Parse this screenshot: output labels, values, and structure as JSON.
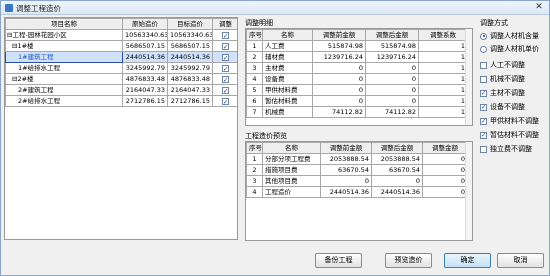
{
  "window": {
    "title": "调整工程造价",
    "close_glyph": "✕"
  },
  "left_table": {
    "headers": [
      "项目名称",
      "原始造价",
      "目标造价",
      "调整"
    ],
    "rows": [
      {
        "name": "⊟工程-园林花园小区",
        "orig": "10563340.63",
        "target": "10563340.63",
        "checked": true,
        "selected": false
      },
      {
        "name": "⊟1#楼",
        "orig": "5686507.15",
        "target": "5686507.15",
        "checked": true,
        "selected": false
      },
      {
        "name": "1#建筑工程",
        "orig": "2440514.36",
        "target": "2440514.36",
        "checked": true,
        "selected": true
      },
      {
        "name": "1#给排水工程",
        "orig": "3245992.79",
        "target": "3245992.79",
        "checked": true,
        "selected": false
      },
      {
        "name": "⊟2#楼",
        "orig": "4876833.48",
        "target": "4876833.48",
        "checked": true,
        "selected": false
      },
      {
        "name": "2#建筑工程",
        "orig": "2164047.33",
        "target": "2164047.33",
        "checked": true,
        "selected": false
      },
      {
        "name": "2#给排水工程",
        "orig": "2712786.15",
        "target": "2712786.15",
        "checked": true,
        "selected": false
      }
    ]
  },
  "detail": {
    "label": "调整明细",
    "headers": [
      "序号",
      "名称",
      "调整前金额",
      "调整后金额",
      "调整系数"
    ],
    "rows": [
      {
        "no": "1",
        "name": "人工费",
        "before": "515874.98",
        "after": "515874.98",
        "coef": "1"
      },
      {
        "no": "2",
        "name": "辅材费",
        "before": "1239716.24",
        "after": "1239716.24",
        "coef": "1"
      },
      {
        "no": "3",
        "name": "主材费",
        "before": "0",
        "after": "0",
        "coef": "1"
      },
      {
        "no": "4",
        "name": "设备费",
        "before": "0",
        "after": "0",
        "coef": "1"
      },
      {
        "no": "5",
        "name": "甲供材料费",
        "before": "0",
        "after": "0",
        "coef": "1"
      },
      {
        "no": "6",
        "name": "暂估材料费",
        "before": "0",
        "after": "0",
        "coef": "1"
      },
      {
        "no": "7",
        "name": "机械费",
        "before": "74112.82",
        "after": "74112.82",
        "coef": "1"
      }
    ]
  },
  "preview": {
    "label": "工程造价预览",
    "headers": [
      "序号",
      "名称",
      "调整前金额",
      "调整后金额",
      "调整金额"
    ],
    "rows": [
      {
        "no": "1",
        "name": "分部分项工程费",
        "before": "2053888.54",
        "after": "2053888.54",
        "diff": "0"
      },
      {
        "no": "2",
        "name": "措施项目费",
        "before": "63670.54",
        "after": "63670.54",
        "diff": "0"
      },
      {
        "no": "3",
        "name": "其他项目费",
        "before": "0",
        "after": "0",
        "diff": "0"
      },
      {
        "no": "4",
        "name": "工程造价",
        "before": "2440514.36",
        "after": "2440514.36",
        "diff": "0"
      }
    ]
  },
  "options": {
    "label": "调整方式",
    "radios": [
      {
        "label": "调整人材机含量",
        "checked": true
      },
      {
        "label": "调整人材机单价",
        "checked": false
      }
    ],
    "checks": [
      {
        "label": "人工不调整",
        "checked": false
      },
      {
        "label": "机械不调整",
        "checked": false
      },
      {
        "label": "主材不调整",
        "checked": true
      },
      {
        "label": "设备不调整",
        "checked": true
      },
      {
        "label": "甲供材料不调整",
        "checked": true
      },
      {
        "label": "暂估材料不调整",
        "checked": true
      },
      {
        "label": "独立费不调整",
        "checked": false
      }
    ]
  },
  "buttons": {
    "backup": "备份工程",
    "preview": "预览造价",
    "ok": "确定",
    "cancel": "取消"
  }
}
